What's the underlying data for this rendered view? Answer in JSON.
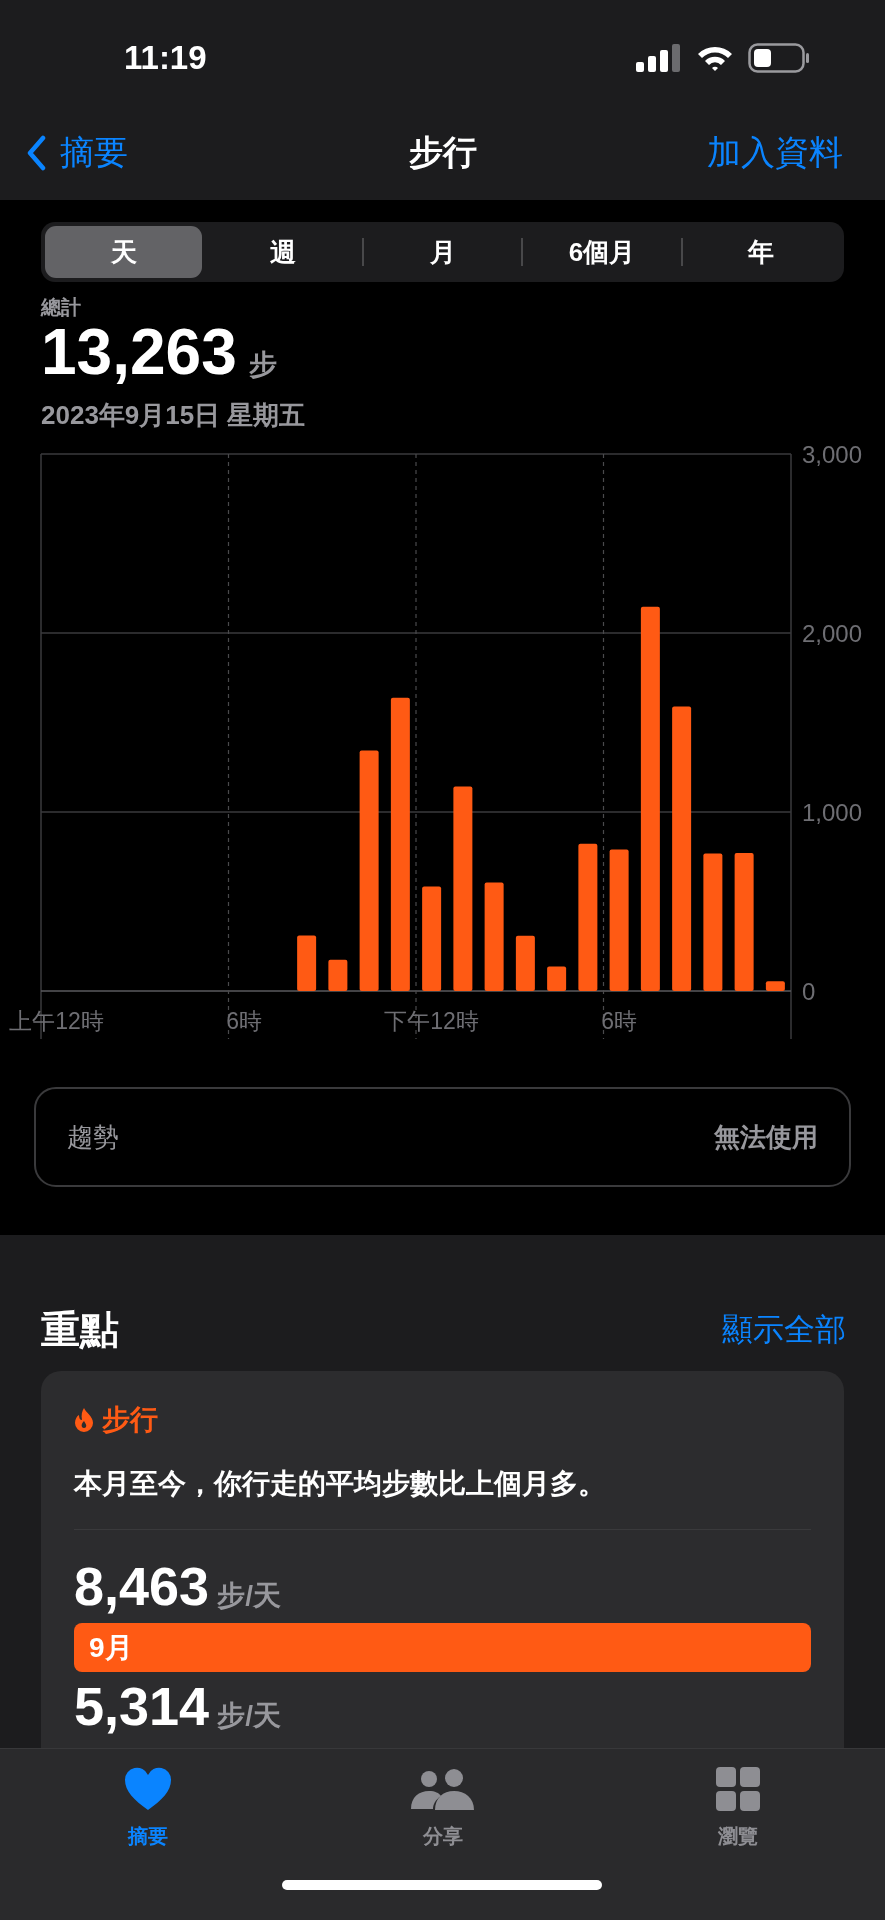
{
  "status_bar": {
    "time": "11:19"
  },
  "nav": {
    "back_label": "摘要",
    "title": "步行",
    "action": "加入資料"
  },
  "range_tabs": [
    {
      "label": "天",
      "selected": true
    },
    {
      "label": "週",
      "selected": false
    },
    {
      "label": "月",
      "selected": false
    },
    {
      "label": "6個月",
      "selected": false
    },
    {
      "label": "年",
      "selected": false
    }
  ],
  "summary": {
    "label": "總計",
    "value": "13,263",
    "unit": "步",
    "date": "2023年9月15日 星期五"
  },
  "chart_data": {
    "type": "bar",
    "categories": [
      "上午12時",
      null,
      null,
      null,
      null,
      null,
      "6時",
      null,
      null,
      null,
      null,
      null,
      "下午12時",
      null,
      null,
      null,
      null,
      null,
      "6時",
      null,
      null,
      null,
      null,
      null
    ],
    "values": [
      0,
      0,
      0,
      0,
      0,
      0,
      0,
      0,
      310,
      175,
      1343,
      1638,
      584,
      1143,
      606,
      308,
      137,
      822,
      790,
      2146,
      1590,
      768,
      771,
      54
    ],
    "ylim": [
      0,
      3000
    ],
    "yticks": [
      {
        "value": 0,
        "label": "0"
      },
      {
        "value": 1000,
        "label": "1,000"
      },
      {
        "value": 2000,
        "label": "2,000"
      },
      {
        "value": 3000,
        "label": "3,000"
      }
    ],
    "grid": true
  },
  "trend": {
    "label": "趨勢",
    "value": "無法使用"
  },
  "highlights": {
    "title": "重點",
    "action": "顯示全部",
    "card": {
      "category": "步行",
      "message": "本月至今，你行走的平均步數比上個月多。",
      "metrics": [
        {
          "value": "8,463",
          "unit": "步/天",
          "bar_label": "9月"
        },
        {
          "value": "5,314",
          "unit": "步/天"
        }
      ]
    }
  },
  "tab_bar": [
    {
      "label": "摘要",
      "selected": true
    },
    {
      "label": "分享",
      "selected": false
    },
    {
      "label": "瀏覽",
      "selected": false
    }
  ]
}
